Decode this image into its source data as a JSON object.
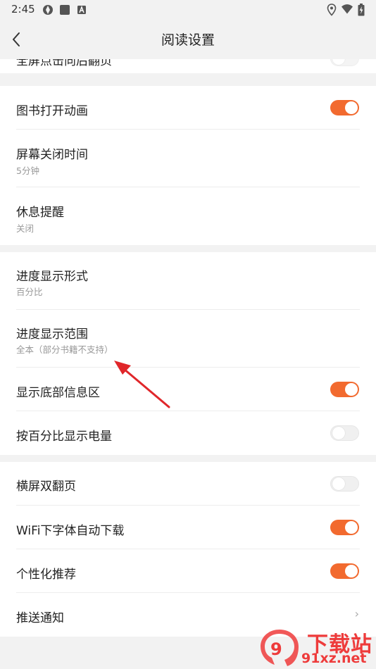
{
  "status_bar": {
    "time": "2:45",
    "left_icons": [
      "app-icon",
      "stop-icon",
      "font-icon"
    ],
    "right_icons": [
      "location-icon",
      "wifi-icon",
      "battery-icon"
    ]
  },
  "header": {
    "title": "阅读设置",
    "back_icon": "chevron-left-icon"
  },
  "clipped_row": {
    "title": "全屏点击向后翻页"
  },
  "groups": [
    {
      "rows": [
        {
          "title": "图书打开动画",
          "control": "toggle",
          "on": true
        },
        {
          "title": "屏幕关闭时间",
          "subtitle": "5分钟"
        },
        {
          "title": "休息提醒",
          "subtitle": "关闭"
        }
      ]
    },
    {
      "rows": [
        {
          "title": "进度显示形式",
          "subtitle": "百分比"
        },
        {
          "title": "进度显示范围",
          "subtitle": "全本（部分书籍不支持）"
        },
        {
          "title": "显示底部信息区",
          "control": "toggle",
          "on": true
        },
        {
          "title": "按百分比显示电量",
          "control": "toggle",
          "on": false
        }
      ]
    },
    {
      "rows": [
        {
          "title": "横屏双翻页",
          "control": "toggle",
          "on": false
        },
        {
          "title": "WiFi下字体自动下载",
          "control": "toggle",
          "on": true
        },
        {
          "title": "个性化推荐",
          "control": "toggle",
          "on": true
        },
        {
          "title": "推送通知",
          "control": "chevron",
          "chevron_glyph": "›"
        }
      ]
    }
  ],
  "colors": {
    "accent": "#f26a2f",
    "annotation_arrow": "#e0262a",
    "background": "#f2f2f2"
  },
  "watermark": {
    "top_text": "下载站",
    "bottom_text": "91xz.net"
  }
}
